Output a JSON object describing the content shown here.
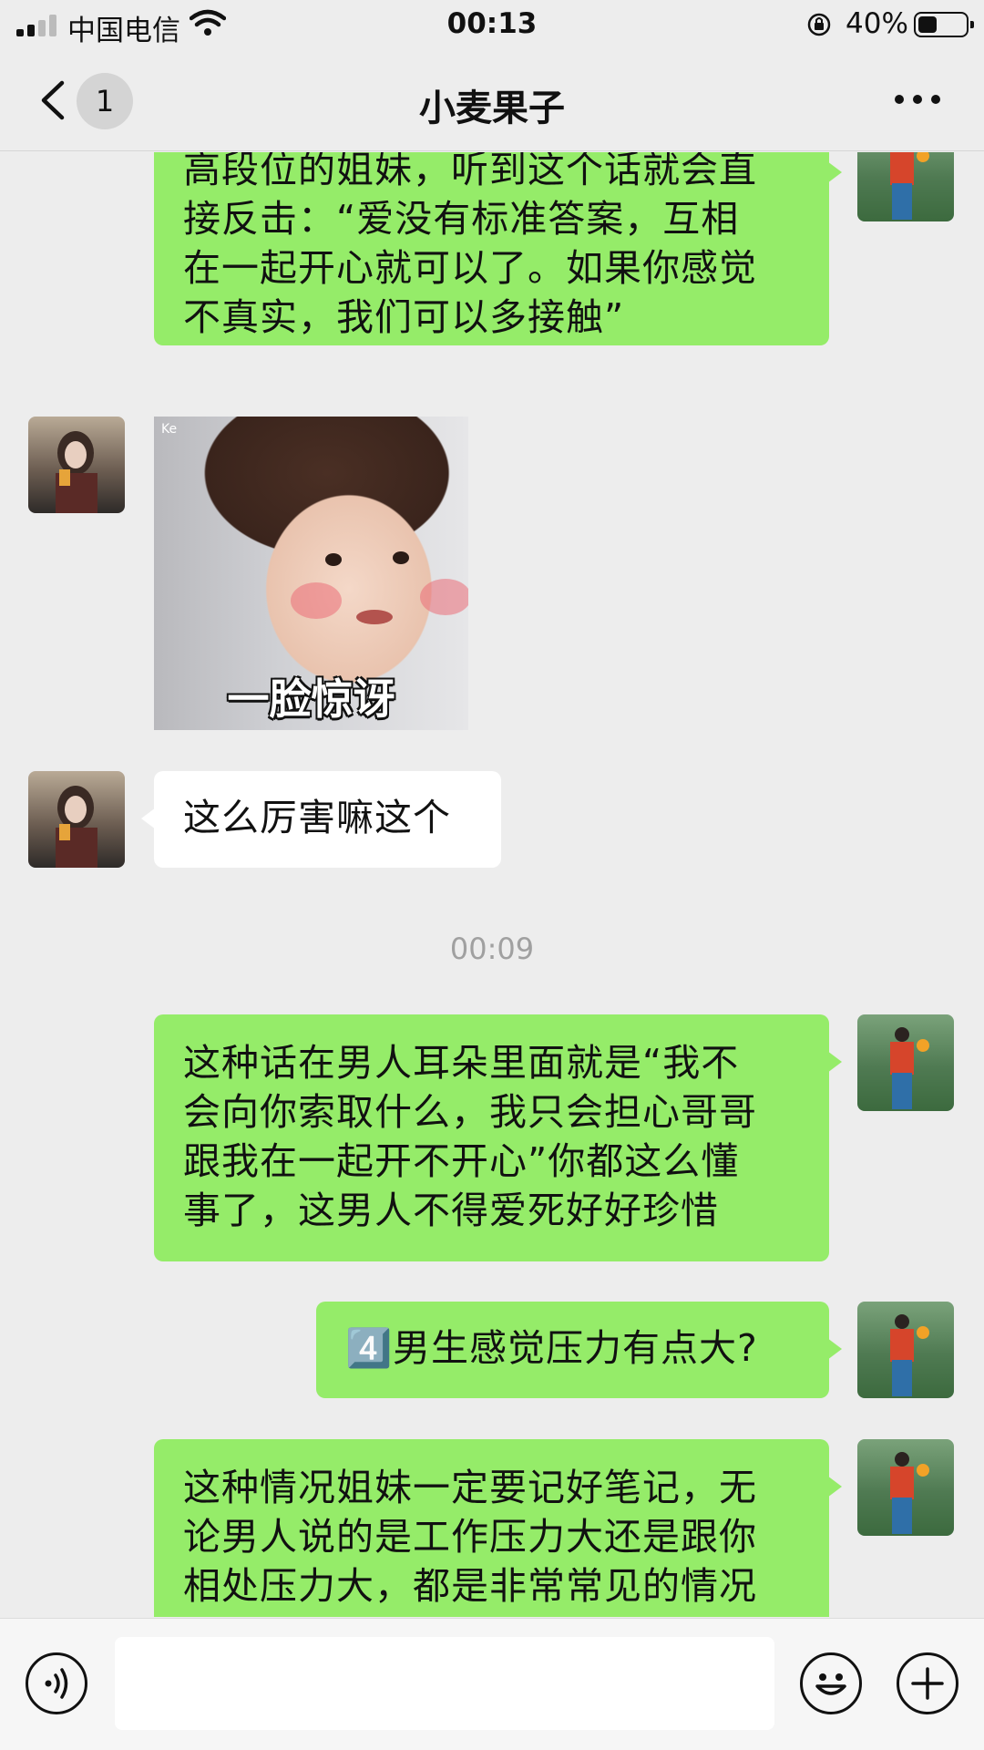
{
  "status_bar": {
    "carrier": "中国电信",
    "time": "00:13",
    "battery_percent": "40%",
    "battery_level": 0.4
  },
  "nav": {
    "unread_count": "1",
    "title": "小麦果子"
  },
  "messages": [
    {
      "sender": "me",
      "lines": [
        "高段位的姐妹，听到这个话就会直",
        "接反击：“爱没有标准答案，互相",
        "在一起开心就可以了。如果你感觉",
        "不真实，我们可以多接触”"
      ]
    },
    {
      "sender": "friend",
      "type": "sticker",
      "caption": "一脸惊讶",
      "watermark": "Ke"
    },
    {
      "sender": "friend",
      "lines": [
        "这么厉害嘛这个"
      ]
    },
    {
      "type": "timestamp",
      "text": "00:09"
    },
    {
      "sender": "me",
      "lines": [
        "这种话在男人耳朵里面就是“我不",
        "会向你索取什么，我只会担心哥哥",
        "跟我在一起开不开心”你都这么懂",
        "事了，这男人不得爱死好好珍惜"
      ]
    },
    {
      "sender": "me",
      "lines": [
        "4️⃣男生感觉压力有点大?"
      ]
    },
    {
      "sender": "me",
      "lines": [
        "这种情况姐妹一定要记好笔记，无",
        "论男人说的是工作压力大还是跟你",
        "相处压力大，都是非常常见的情况"
      ]
    }
  ],
  "icons": {
    "back": "chevron-left-icon",
    "more": "more-dots-icon",
    "voice": "voice-icon",
    "emoji": "emoji-icon",
    "add": "plus-icon"
  },
  "colors": {
    "my_bubble": "#95ec69",
    "friend_bubble": "#ffffff",
    "background": "#ededed"
  }
}
